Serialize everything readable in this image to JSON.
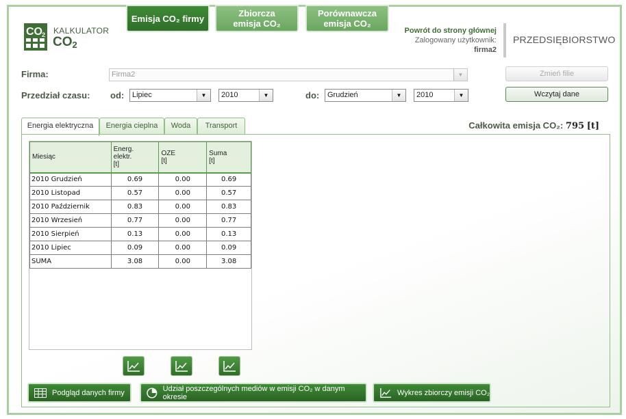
{
  "logo": {
    "line1": "KALKULATOR",
    "line2": "CO",
    "line2_sub": "2"
  },
  "nav": [
    {
      "line1": "Emisja CO₂ firmy",
      "line2": ""
    },
    {
      "line1": "Zbiorcza",
      "line2": "emisja CO₂"
    },
    {
      "line1": "Porównawcza",
      "line2": "emisja CO₂"
    }
  ],
  "user": {
    "home_link": "Powrót do strony głównej",
    "logged_label": "Zalogowany użytkownik:",
    "username": "firma2",
    "company_type": "PRZEDSIĘBIORSTWO"
  },
  "form": {
    "firma_label": "Firma:",
    "firma_value": "Firma2",
    "change_file_label": "Zmień filie",
    "period_label": "Przedział czasu:",
    "from_label": "od:",
    "from_month": "Lipiec",
    "from_year": "2010",
    "to_label": "do:",
    "to_month": "Grudzień",
    "to_year": "2010",
    "load_label": "Wczytaj dane"
  },
  "tabs": [
    "Energia elektryczna",
    "Energia cieplna",
    "Woda",
    "Transport"
  ],
  "total": {
    "label": "Całkowita emisja CO₂:",
    "value": "795",
    "unit": "[t]"
  },
  "table": {
    "headers": [
      {
        "l1": "Miesiąc",
        "l2": "",
        "l3": ""
      },
      {
        "l1": "Energ.",
        "l2": "elektr.",
        "l3": "[t]"
      },
      {
        "l1": "OZE",
        "l2": "[t]",
        "l3": ""
      },
      {
        "l1": "Suma",
        "l2": "[t]",
        "l3": ""
      }
    ],
    "rows": [
      [
        "2010 Grudzień",
        "0.69",
        "0.00",
        "0.69"
      ],
      [
        "2010 Listopad",
        "0.57",
        "0.00",
        "0.57"
      ],
      [
        "2010 Październik",
        "0.83",
        "0.00",
        "0.83"
      ],
      [
        "2010 Wrzesień",
        "0.77",
        "0.00",
        "0.77"
      ],
      [
        "2010 Sierpień",
        "0.13",
        "0.00",
        "0.13"
      ],
      [
        "2010 Lipiec",
        "0.09",
        "0.00",
        "0.09"
      ],
      [
        "SUMA",
        "3.08",
        "0.00",
        "3.08"
      ]
    ]
  },
  "buttons": {
    "preview": "Podgląd danych firmy",
    "share": "Udział poszczególnych mediów w emisji CO₂ w danym okresie",
    "chart": "Wykres zbiorczy emisji CO₂"
  },
  "colors": {
    "accent": "#2f6f29",
    "light_accent": "#8cc081",
    "border": "#a9cfa1"
  }
}
